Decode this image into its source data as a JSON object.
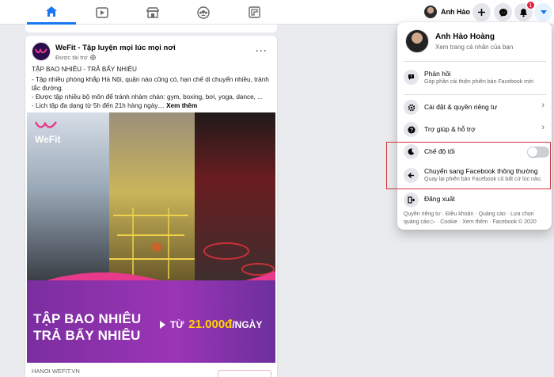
{
  "topbar": {
    "profile_name": "Anh Hào",
    "notification_count": "1",
    "tabs": [
      "home",
      "watch",
      "marketplace",
      "groups",
      "gaming"
    ],
    "accent_color": "#1877f2"
  },
  "post": {
    "page_name": "WeFit - Tập luyện mọi lúc mọi nơi",
    "sponsored": "Được tài trợ",
    "lines": [
      "TẬP BAO NHIÊU - TRẢ BẤY NHIÊU",
      "- Tập nhiều phòng khắp Hà Nội, quận nào cũng có, hạn chế di chuyển nhiều, tránh tắc đường.",
      "- Được tập nhiều bộ môn để tránh nhàm chán: gym, boxing, bơi, yoga, dance, ...",
      "- Lịch tập đa dạng từ 5h đến 21h hàng ngày...."
    ],
    "see_more": "Xem thêm",
    "logo_text": "WeFit",
    "banner_line1": "TẬP BAO NHIÊU",
    "banner_line2": "TRẢ BẤY NHIÊU",
    "banner_from": "TỪ",
    "banner_amount": "21.000đ",
    "banner_unit": "/NGÀY",
    "footer_url": "HANOI.WEFIT.VN"
  },
  "menu": {
    "user_name": "Anh Hào Hoàng",
    "user_sub": "Xem trang cá nhân của bạn",
    "feedback_label": "Phản hồi",
    "feedback_sub": "Góp phần cải thiện phiên bản Facebook mới",
    "settings_label": "Cài đặt & quyền riêng tư",
    "help_label": "Trợ giúp & hỗ trợ",
    "dark_mode_label": "Chế độ tối",
    "dark_mode_on": false,
    "classic_label": "Chuyển sang Facebook thông thường",
    "classic_sub": "Quay lại phiên bản Facebook cũ bất cứ lúc nào.",
    "logout_label": "Đăng xuất",
    "footer_line1": "Quyền riêng tư · Điều khoản · Quảng cáo · Lựa chọn",
    "footer_line2": "quảng cáo ▷ · Cookie · Xem thêm · Facebook © 2020"
  }
}
